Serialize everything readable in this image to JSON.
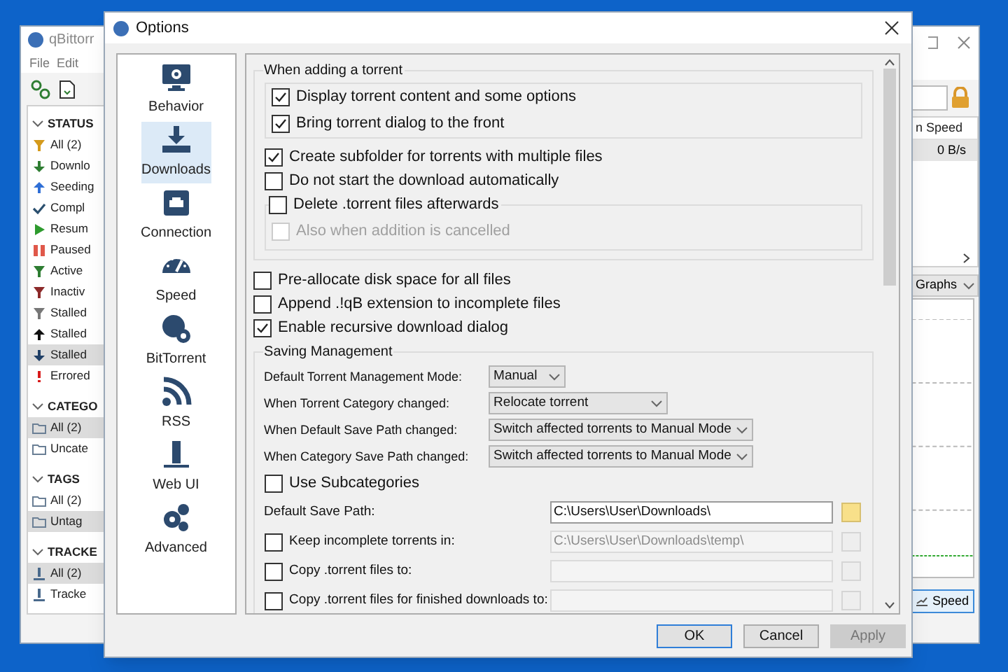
{
  "main_window": {
    "title": "qBittorr",
    "menu": [
      "File",
      "Edit"
    ],
    "sidebar": [
      {
        "title": "STATUS",
        "items": [
          {
            "label": "All (2)",
            "selected": false
          },
          {
            "label": "Downlo",
            "selected": false
          },
          {
            "label": "Seeding",
            "selected": false
          },
          {
            "label": "Compl",
            "selected": false
          },
          {
            "label": "Resum",
            "selected": false
          },
          {
            "label": "Paused",
            "selected": false
          },
          {
            "label": "Active",
            "selected": false
          },
          {
            "label": "Inactiv",
            "selected": false
          },
          {
            "label": "Stalled",
            "selected": false
          },
          {
            "label": "Stalled",
            "selected": false
          },
          {
            "label": "Stalled",
            "selected": true
          },
          {
            "label": "Errored",
            "selected": false
          }
        ]
      },
      {
        "title": "CATEGO",
        "items": [
          {
            "label": "All (2)",
            "selected": true
          },
          {
            "label": "Uncate",
            "selected": false
          }
        ]
      },
      {
        "title": "TAGS",
        "items": [
          {
            "label": "All (2)",
            "selected": false
          },
          {
            "label": "Untag",
            "selected": true
          }
        ]
      },
      {
        "title": "TRACKE",
        "items": [
          {
            "label": "All (2)",
            "selected": true
          },
          {
            "label": "Tracke",
            "selected": false
          }
        ]
      }
    ],
    "table": {
      "column": "n Speed",
      "cell": "0 B/s"
    },
    "graphs_dropdown": "Graphs",
    "speed_tab": {
      "label": "Speed",
      "selected": true
    }
  },
  "options": {
    "title": "Options",
    "pages": [
      {
        "label": "Behavior",
        "selected": false
      },
      {
        "label": "Downloads",
        "selected": true
      },
      {
        "label": "Connection",
        "selected": false
      },
      {
        "label": "Speed",
        "selected": false
      },
      {
        "label": "BitTorrent",
        "selected": false
      },
      {
        "label": "RSS",
        "selected": false
      },
      {
        "label": "Web UI",
        "selected": false
      },
      {
        "label": "Advanced",
        "selected": false
      }
    ],
    "when_adding": {
      "title": "When adding a torrent",
      "content_options": [
        {
          "label": "Display torrent content and some options",
          "checked": true
        },
        {
          "label": "Bring torrent dialog to the front",
          "checked": true
        }
      ],
      "create_subfolder": {
        "label": "Create subfolder for torrents with multiple files",
        "checked": true
      },
      "do_not_start": {
        "label": "Do not start the download automatically",
        "checked": false
      },
      "delete_torrent": {
        "label": "Delete .torrent files afterwards",
        "checked": false
      },
      "also_cancelled": {
        "label": "Also when addition is cancelled",
        "checked": false,
        "disabled": true
      }
    },
    "general_options": [
      {
        "label": "Pre-allocate disk space for all files",
        "checked": false
      },
      {
        "label": "Append .!qB extension to incomplete files",
        "checked": false
      },
      {
        "label": "Enable recursive download dialog",
        "checked": true
      }
    ],
    "saving": {
      "title": "Saving Management",
      "combos": [
        {
          "label": "Default Torrent Management Mode:",
          "value": "Manual",
          "kind": "short"
        },
        {
          "label": "When Torrent Category changed:",
          "value": "Relocate torrent",
          "kind": "medium"
        },
        {
          "label": "When Default Save Path changed:",
          "value": "Switch affected torrents to Manual Mode",
          "kind": "long"
        },
        {
          "label": "When Category Save Path changed:",
          "value": "Switch affected torrents to Manual Mode",
          "kind": "long"
        }
      ],
      "use_subcategories": {
        "label": "Use Subcategories",
        "checked": false
      },
      "paths": [
        {
          "kind": "plain",
          "label": "Default Save Path:",
          "value": "C:\\Users\\User\\Downloads\\",
          "disabled": false
        },
        {
          "kind": "checkbox",
          "label": "Keep incomplete torrents in:",
          "checked": false,
          "value": "C:\\Users\\User\\Downloads\\temp\\",
          "disabled": true
        },
        {
          "kind": "checkbox",
          "label": "Copy .torrent files to:",
          "checked": false,
          "disabled": true
        },
        {
          "kind": "checkbox",
          "label": "Copy .torrent files for finished downloads to:",
          "checked": false,
          "disabled": true
        }
      ]
    },
    "buttons": [
      {
        "label": "OK",
        "default": true,
        "disabled": false
      },
      {
        "label": "Cancel",
        "default": false,
        "disabled": false
      },
      {
        "label": "Apply",
        "default": false,
        "disabled": true
      }
    ]
  }
}
